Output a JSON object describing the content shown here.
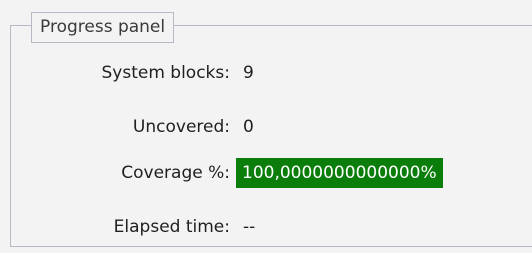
{
  "panel": {
    "title": "Progress panel"
  },
  "rows": [
    {
      "label": "System blocks:",
      "value": "9"
    },
    {
      "label": "Uncovered:",
      "value": "0"
    },
    {
      "label": "Coverage %:",
      "value": "100,0000000000000%"
    },
    {
      "label": "Elapsed time:",
      "value": "--"
    }
  ],
  "colors": {
    "coverage_highlight": "#0a7d0a",
    "coverage_text": "#ffffff",
    "border": "#b9b9c6"
  }
}
